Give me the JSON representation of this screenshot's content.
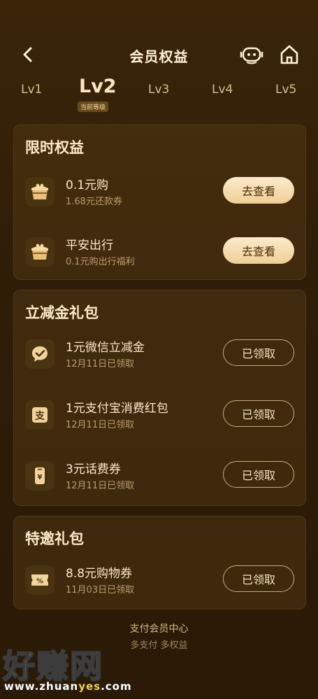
{
  "header": {
    "title": "会员权益",
    "back_icon": "chevron-left-icon",
    "service_icon": "robot-icon",
    "home_icon": "home-icon"
  },
  "levels": {
    "items": [
      "Lv1",
      "Lv2",
      "Lv3",
      "Lv4",
      "Lv5"
    ],
    "current_badge": "当前等级"
  },
  "limited": {
    "title": "限时权益",
    "items": [
      {
        "name": "0.1元购",
        "sub": "1.68元还款券",
        "button": "去查看",
        "icon": "gift-box-icon"
      },
      {
        "name": "平安出行",
        "sub": "0.1元购出行福利",
        "button": "去查看",
        "icon": "gift-box-icon"
      }
    ]
  },
  "discount": {
    "title": "立减金礼包",
    "items": [
      {
        "name": "1元微信立减金",
        "sub": "12月11日已领取",
        "button": "已领取",
        "icon": "wechat-icon"
      },
      {
        "name": "1元支付宝消费红包",
        "sub": "12月11日已领取",
        "button": "已领取",
        "icon": "alipay-icon"
      },
      {
        "name": "3元话费券",
        "sub": "12月11日已领取",
        "button": "已领取",
        "icon": "phone-bill-icon"
      }
    ]
  },
  "special": {
    "title": "特邀礼包",
    "items": [
      {
        "name": "8.8元购物券",
        "sub": "11月03日已领取",
        "button": "已领取",
        "icon": "coupon-icon"
      }
    ]
  },
  "footer": {
    "title": "支付会员中心",
    "subtitle": "多支付 多权益"
  },
  "watermark": {
    "text": "好赚网",
    "url_prefix": "www.zhuan",
    "url_highlight": "yes",
    "url_suffix": ".com"
  },
  "colors": {
    "background": "#2e1d07",
    "gold_button": "#f0cf96",
    "text_primary": "#fbe9c8",
    "text_secondary": "#b99c6e"
  }
}
